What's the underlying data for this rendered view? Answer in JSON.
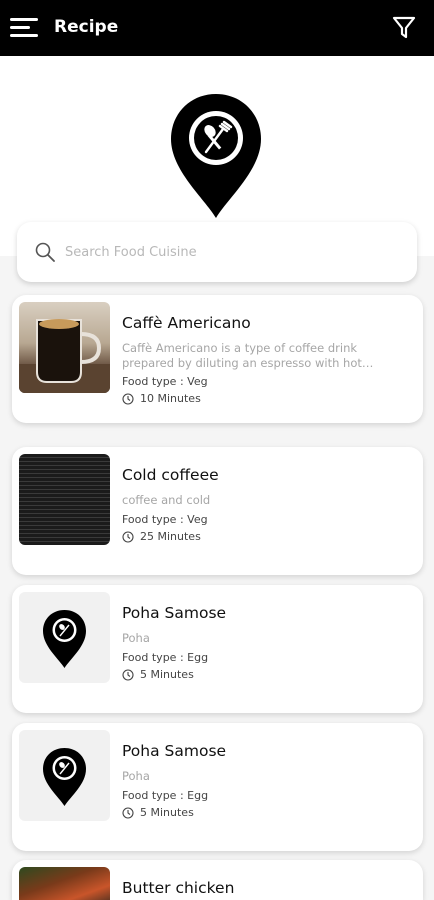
{
  "appbar": {
    "title": "Recipe",
    "menu_icon": "hamburger-menu-icon",
    "filter_icon": "filter-funnel-icon"
  },
  "logo_icon": "location-pin-fork-spoon-icon",
  "search": {
    "placeholder": "Search Food Cuisine",
    "value": "",
    "icon": "search-icon"
  },
  "recipes": [
    {
      "title": "Caffè Americano",
      "description": "Caffè Americano is a type of coffee drink prepared by diluting an espresso with hot…",
      "food_type": "Food type : Veg",
      "time": "10 Minutes",
      "thumb": "coffee-cup-photo"
    },
    {
      "title": "Cold coffeee",
      "description": "coffee and cold",
      "food_type": "Food type : Veg",
      "time": "25 Minutes",
      "thumb": "dark-screenshot-image"
    },
    {
      "title": "Poha Samose",
      "description": "Poha",
      "food_type": "Food type : Egg",
      "time": "5 Minutes",
      "thumb": "placeholder-logo"
    },
    {
      "title": "Poha Samose",
      "description": "Poha",
      "food_type": "Food type : Egg",
      "time": "5 Minutes",
      "thumb": "placeholder-logo"
    },
    {
      "title": "Butter chicken",
      "thumb": "butter-chicken-photo"
    }
  ],
  "colors": {
    "appbar": "#000000",
    "background": "#f5f5f5",
    "card": "#ffffff",
    "muted_text": "#a6a6a6"
  }
}
